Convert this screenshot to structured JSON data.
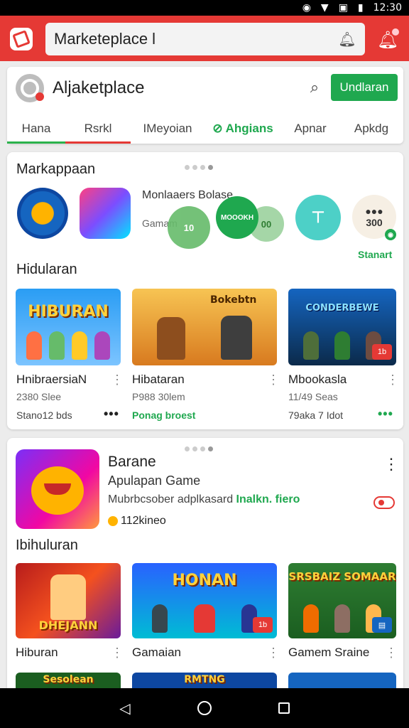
{
  "status": {
    "time": "12:30"
  },
  "topbar": {
    "search_value": "Marketeplace l"
  },
  "header": {
    "title": "Aljaketplace",
    "install_label": "Undlaran",
    "tabs": [
      {
        "label": "Hana"
      },
      {
        "label": "Rsrkl"
      },
      {
        "label": "IMeyoian"
      },
      {
        "label": "Ahgians"
      },
      {
        "label": "Apnar"
      },
      {
        "label": "Apkdg"
      }
    ]
  },
  "market": {
    "title": "Markappaan",
    "promo_title": "Monlaaers Bolase",
    "promo_sub": "Gamam",
    "circle1": "10",
    "circle2": "MOOOKH",
    "circle3": "00",
    "circle5": "300",
    "start_label": "Stanart",
    "row_title": "Hidularan",
    "games": [
      {
        "title": "HnibraersiaN",
        "meta": "2380 Slee",
        "price": "Stano12 bds",
        "thumb_label": "HIBURAN"
      },
      {
        "title": "Hibataran",
        "meta": "P988 30lem",
        "price": "Ponag broest",
        "thumb_label": "Bokebtn"
      },
      {
        "title": "Mbookasla",
        "meta": "11/49 Seas",
        "price": "79aka 7 Idot",
        "thumb_label": "CONDERBEWE"
      }
    ]
  },
  "featured": {
    "name": "Barane",
    "sub": "Apulapan Game",
    "desc": "Mubrbcsober adplkasard",
    "desc_highlight": "Inalkn. fiero",
    "coins": "112kineo",
    "row_title": "Ibihuluran",
    "games": [
      {
        "title": "Hiburan",
        "thumb_label": "DHEJANN"
      },
      {
        "title": "Gamaian",
        "thumb_label": "HONAN"
      },
      {
        "title": "Gamem Sraine",
        "thumb_label": "SRSBAIZ SOMAAR"
      }
    ],
    "bottom_thumbs": [
      "Sesolean",
      "RMTNG",
      ""
    ]
  },
  "colors": {
    "accent_red": "#e53935",
    "accent_green": "#1fa84f"
  }
}
